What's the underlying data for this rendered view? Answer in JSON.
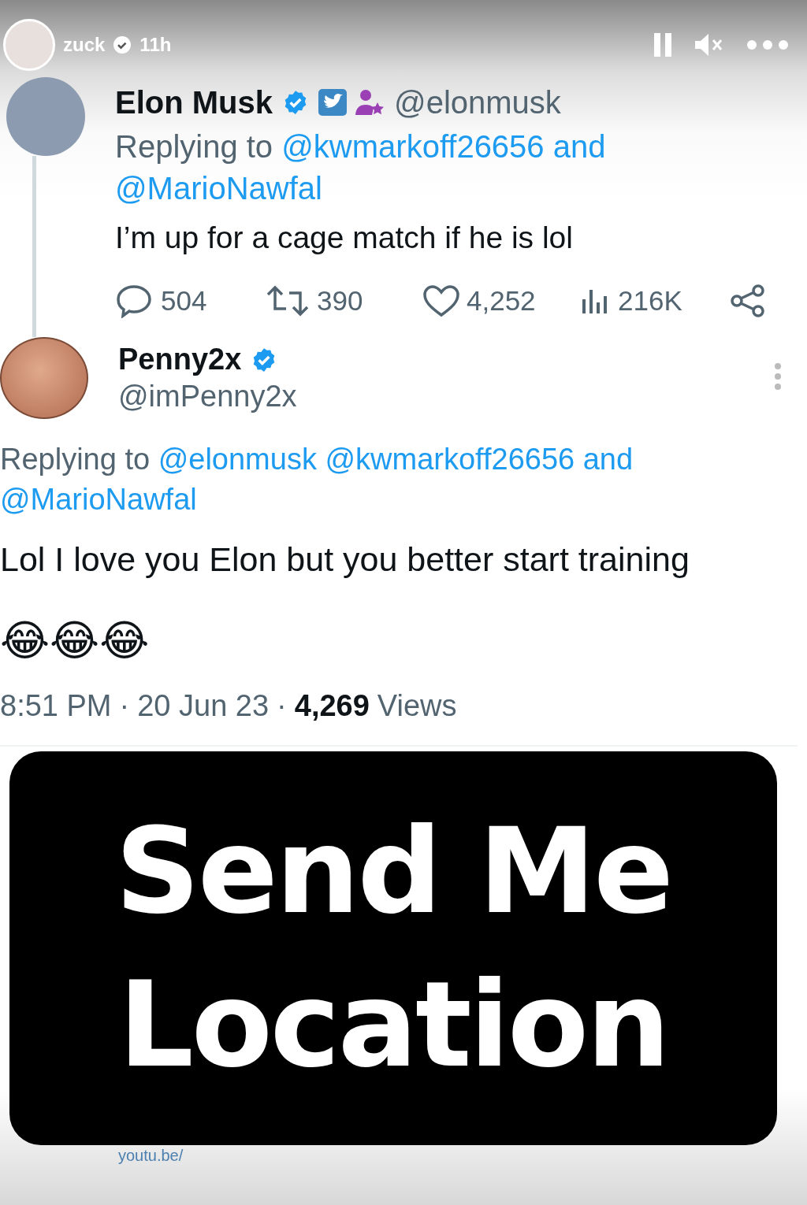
{
  "story": {
    "user": "zuck",
    "verified": true,
    "time": "11h",
    "paused": true,
    "muted": true
  },
  "thread_tweet": {
    "name": "Elon Musk",
    "verified": true,
    "handle": "@elonmusk",
    "replying_label": "Replying to",
    "mentions": [
      "@kwmarkoff26656 and",
      "@MarioNawfal"
    ],
    "text": "I’m up for a cage match if he is lol",
    "stats": [
      {
        "kind": "reply",
        "count": "504"
      },
      {
        "kind": "retweet",
        "count": "390"
      },
      {
        "kind": "like",
        "count": "4,252"
      },
      {
        "kind": "views",
        "count": "216K"
      },
      {
        "kind": "share"
      }
    ]
  },
  "reply_tweet": {
    "name": "Penny2x",
    "verified": true,
    "handle": "@imPenny2x",
    "replying_label": "Replying to",
    "mentions": [
      "@elonmusk",
      "@kwmarkoff26656 and",
      "@MarioNawfal"
    ],
    "text": "Lol I love you Elon but you better start training",
    "emoji": "😂😂😂",
    "time": "8:51 PM",
    "separator": "·",
    "date": "20 Jun 23",
    "views_count": "4,269",
    "views_label": "Views"
  },
  "sticker": {
    "lines": [
      "Send Me",
      "Location"
    ]
  },
  "link_below": "youtu.be/"
}
